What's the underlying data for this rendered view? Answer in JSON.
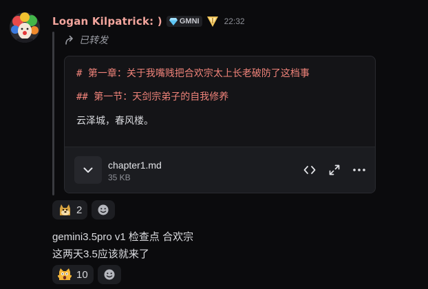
{
  "message": {
    "author": "Logan Kilpatrick: )",
    "tag": "GMNI",
    "timestamp": "22:32",
    "forward_label": "已转发"
  },
  "forwarded": {
    "lines": {
      "h1": "# 第一章：关于我嘴贱把合欢宗太上长老破防了这档事",
      "h2": "## 第一节：天剑宗弟子的自我修养",
      "p": "云泽城，春风楼。"
    },
    "attachment": {
      "filename": "chapter1.md",
      "size": "35 KB"
    }
  },
  "reactions_1": {
    "count": "2"
  },
  "text_lines": [
    "gemini3.5pro v1 检查点 合欢宗",
    "这两天3.5应该就来了"
  ],
  "reactions_2": {
    "count": "10"
  },
  "colors": {
    "username": "#f2a59d",
    "markdown_heading": "#f0837a",
    "background": "#0b0b0d",
    "card": "#141417"
  },
  "icons": {
    "reaction_1": "doge-icon",
    "reaction_2": "screaming-cat-icon"
  }
}
